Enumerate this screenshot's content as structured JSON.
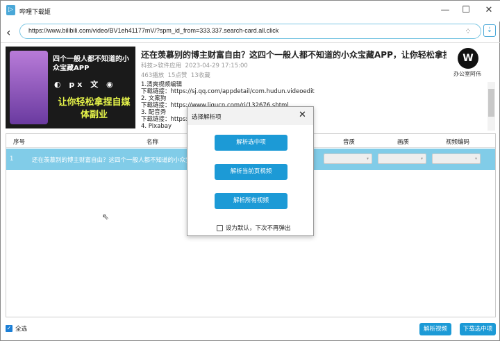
{
  "window": {
    "title": "哔哩下载姬",
    "minimize": "—",
    "maximize": "☐",
    "close": "✕"
  },
  "nav": {
    "back": "‹",
    "url": "https://www.bilibili.com/video/BV1eh41177mV/?spm_id_from=333.337.search-card.all.click",
    "spinner": "⁘",
    "download_icon": "⇣"
  },
  "thumbnail": {
    "line1": "四个一般人都不知道的小众宝藏APP",
    "icons": "◐ px 文 ◉",
    "line2": "让你轻松拿捏自媒体副业"
  },
  "video": {
    "title": "还在羡慕别的博主财富自由？这四个一般人都不知道的小众宝藏APP，让你轻松拿捏自媒体...",
    "category": "科技>软件应用",
    "date": "2023-04-29 17:15:00",
    "plays": "463播放",
    "likes": "15点赞",
    "favorites": "13收藏",
    "author_logo": "W",
    "author": "办公室阿伟",
    "description": [
      "1.清爽视频编辑",
      "下载链接：https://sj.qq.com/appdetail/com.hudun.videoedit",
      "2. 文案狗",
      "下载链接：https://www.liqucn.com/rj/132676.shtml",
      "3. 配音秀",
      "下载链接：https://",
      "4. Pixabay"
    ]
  },
  "table": {
    "headers": [
      "序号",
      "名称",
      "音质",
      "画质",
      "视频编码"
    ],
    "rows": [
      {
        "index": "1",
        "name": "还在羡慕别的博主财富自由？这四个一般人都不知道的小众宝藏APP",
        "audio": "",
        "video": "",
        "codec": ""
      }
    ]
  },
  "dialog": {
    "title": "选择解析项",
    "close": "✕",
    "buttons": [
      "解析选中项",
      "解析当前页视频",
      "解析所有视频"
    ],
    "checkbox_label": "设为默认，下次不再弹出",
    "checked": false
  },
  "footer": {
    "select_all": "全选",
    "select_all_checked": true,
    "parse_button": "解析视频",
    "download_button": "下载选中项"
  }
}
